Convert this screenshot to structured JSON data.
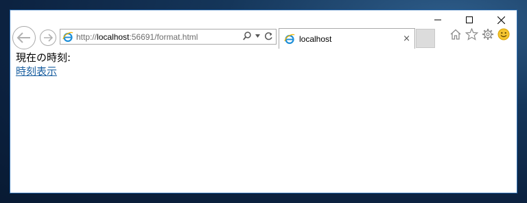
{
  "browser": {
    "url_prefix": "http://",
    "url_host": "localhost",
    "url_rest": ":56691/format.html",
    "tab_title": "localhost",
    "tab_close": "×"
  },
  "page": {
    "label": "現在の時刻:",
    "link": "時刻表示"
  },
  "icons": {
    "back": "back-arrow-icon",
    "forward": "forward-arrow-icon",
    "ie": "internet-explorer-icon",
    "search": "search-icon",
    "refresh": "refresh-icon",
    "home": "home-icon",
    "favorites": "star-icon",
    "settings": "gear-icon",
    "feedback": "smiley-icon"
  },
  "colors": {
    "link": "#1a5fa0",
    "window_border": "#2b6cb0",
    "ie_blue": "#1e8fd8"
  }
}
